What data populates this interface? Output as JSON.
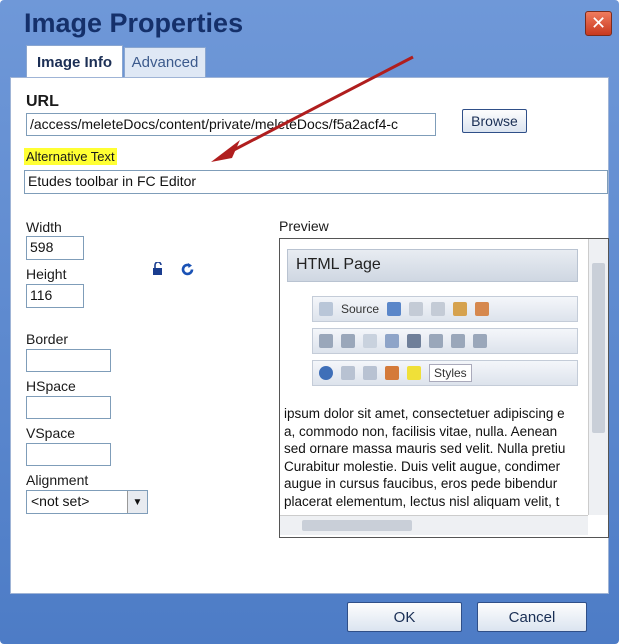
{
  "dialog": {
    "title": "Image Properties",
    "close_glyph": "✕",
    "tabs": [
      {
        "label": "Image Info",
        "active": true
      },
      {
        "label": "Advanced",
        "active": false
      }
    ]
  },
  "fields": {
    "url_label": "URL",
    "url_value": "/access/meleteDocs/content/private/meleteDocs/f5a2acf4-c",
    "browse_label": "Browse",
    "alt_label": "Alternative Text",
    "alt_value": "Etudes toolbar in FC Editor",
    "width_label": "Width",
    "width_value": "598",
    "height_label": "Height",
    "height_value": "116",
    "border_label": "Border",
    "border_value": "",
    "hspace_label": "HSpace",
    "hspace_value": "",
    "vspace_label": "VSpace",
    "vspace_value": "",
    "alignment_label": "Alignment",
    "alignment_value": "<not set>"
  },
  "preview": {
    "label": "Preview",
    "page_title": "HTML Page",
    "source_label": "Source",
    "styles_label": "Styles",
    "text_lines": [
      "ipsum dolor sit amet, consectetuer adipiscing e",
      "a, commodo non, facilisis vitae, nulla. Aenean",
      "sed ornare massa mauris sed velit. Nulla pretiu",
      "Curabitur molestie. Duis velit augue, condimer",
      "augue in cursus faucibus, eros pede bibendur",
      "placerat elementum, lectus nisl aliquam velit, t"
    ]
  },
  "footer": {
    "ok_label": "OK",
    "cancel_label": "Cancel"
  },
  "colors": {
    "arrow": "#b01e1e",
    "highlight": "#ffff33",
    "frame": "#5583cc"
  }
}
